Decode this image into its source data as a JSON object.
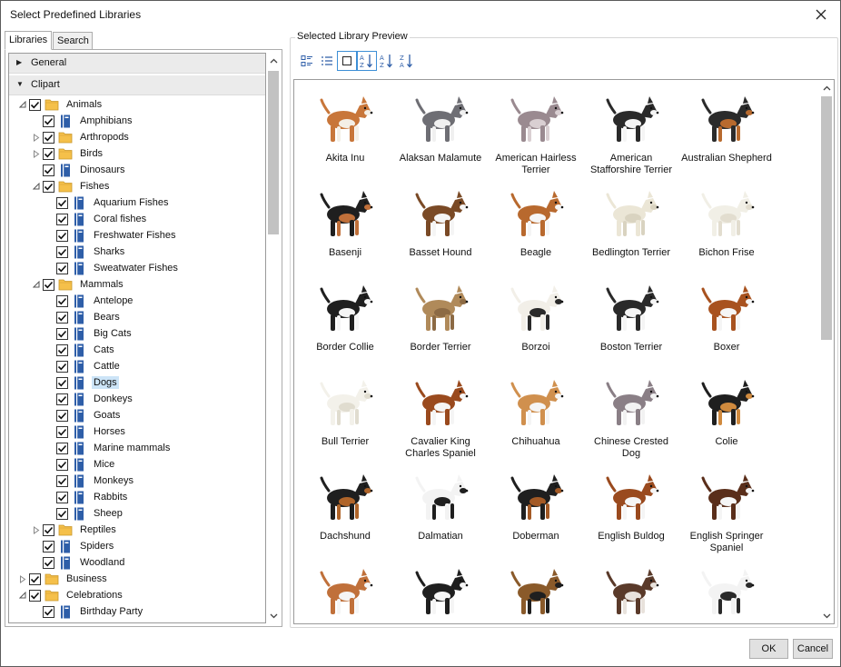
{
  "window": {
    "title": "Select Predefined Libraries"
  },
  "tabs": [
    {
      "label": "Libraries",
      "active": true
    },
    {
      "label": "Search",
      "active": false
    }
  ],
  "groups": [
    {
      "label": "General",
      "expanded": false
    },
    {
      "label": "Clipart",
      "expanded": true
    }
  ],
  "tree": [
    {
      "label": "Animals",
      "level": 0,
      "type": "folder",
      "expander": "open",
      "checked": true
    },
    {
      "label": "Amphibians",
      "level": 1,
      "type": "book",
      "expander": "none",
      "checked": true
    },
    {
      "label": "Arthropods",
      "level": 1,
      "type": "folder",
      "expander": "closed",
      "checked": true
    },
    {
      "label": "Birds",
      "level": 1,
      "type": "folder",
      "expander": "closed",
      "checked": true
    },
    {
      "label": "Dinosaurs",
      "level": 1,
      "type": "book",
      "expander": "none",
      "checked": true
    },
    {
      "label": "Fishes",
      "level": 1,
      "type": "folder",
      "expander": "open",
      "checked": true
    },
    {
      "label": "Aquarium Fishes",
      "level": 2,
      "type": "book",
      "expander": "none",
      "checked": true
    },
    {
      "label": "Coral fishes",
      "level": 2,
      "type": "book",
      "expander": "none",
      "checked": true
    },
    {
      "label": "Freshwater Fishes",
      "level": 2,
      "type": "book",
      "expander": "none",
      "checked": true
    },
    {
      "label": "Sharks",
      "level": 2,
      "type": "book",
      "expander": "none",
      "checked": true
    },
    {
      "label": "Sweatwater Fishes",
      "level": 2,
      "type": "book",
      "expander": "none",
      "checked": true
    },
    {
      "label": "Mammals",
      "level": 1,
      "type": "folder",
      "expander": "open",
      "checked": true
    },
    {
      "label": "Antelope",
      "level": 2,
      "type": "book",
      "expander": "none",
      "checked": true
    },
    {
      "label": "Bears",
      "level": 2,
      "type": "book",
      "expander": "none",
      "checked": true
    },
    {
      "label": "Big Cats",
      "level": 2,
      "type": "book",
      "expander": "none",
      "checked": true
    },
    {
      "label": "Cats",
      "level": 2,
      "type": "book",
      "expander": "none",
      "checked": true
    },
    {
      "label": "Cattle",
      "level": 2,
      "type": "book",
      "expander": "none",
      "checked": true
    },
    {
      "label": "Dogs",
      "level": 2,
      "type": "book",
      "expander": "none",
      "checked": true,
      "selected": true
    },
    {
      "label": "Donkeys",
      "level": 2,
      "type": "book",
      "expander": "none",
      "checked": true
    },
    {
      "label": "Goats",
      "level": 2,
      "type": "book",
      "expander": "none",
      "checked": true
    },
    {
      "label": "Horses",
      "level": 2,
      "type": "book",
      "expander": "none",
      "checked": true
    },
    {
      "label": "Marine mammals",
      "level": 2,
      "type": "book",
      "expander": "none",
      "checked": true
    },
    {
      "label": "Mice",
      "level": 2,
      "type": "book",
      "expander": "none",
      "checked": true
    },
    {
      "label": "Monkeys",
      "level": 2,
      "type": "book",
      "expander": "none",
      "checked": true
    },
    {
      "label": "Rabbits",
      "level": 2,
      "type": "book",
      "expander": "none",
      "checked": true
    },
    {
      "label": "Sheep",
      "level": 2,
      "type": "book",
      "expander": "none",
      "checked": true
    },
    {
      "label": "Reptiles",
      "level": 1,
      "type": "folder",
      "expander": "closed",
      "checked": true
    },
    {
      "label": "Spiders",
      "level": 1,
      "type": "book",
      "expander": "none",
      "checked": true
    },
    {
      "label": "Woodland",
      "level": 1,
      "type": "book",
      "expander": "none",
      "checked": true
    },
    {
      "label": "Business",
      "level": 0,
      "type": "folder",
      "expander": "closed",
      "checked": true
    },
    {
      "label": "Celebrations",
      "level": 0,
      "type": "folder",
      "expander": "open",
      "checked": true
    },
    {
      "label": "Birthday Party",
      "level": 1,
      "type": "book",
      "expander": "none",
      "checked": true
    }
  ],
  "preview": {
    "legend": "Selected Library Preview",
    "view_modes": [
      "details-icon",
      "list-icon",
      "thumbnail-icon",
      "sort-az-icon",
      "sort-ascending-icon",
      "sort-descending-icon"
    ],
    "active_view": "thumbnail-icon",
    "items": [
      {
        "name": "Akita Inu",
        "coat": "#c8763a",
        "accent": "#f4efe6"
      },
      {
        "name": "Alaksan Malamute",
        "coat": "#6e6e74",
        "accent": "#f0f0f0"
      },
      {
        "name": "American Hairless Terrier",
        "coat": "#9a8a90",
        "accent": "#d9cfd2"
      },
      {
        "name": "American Stafforshire Terrier",
        "coat": "#2a2a2a",
        "accent": "#f5f5f5"
      },
      {
        "name": "Australian Shepherd",
        "coat": "#2b2b2b",
        "accent": "#b86a2e"
      },
      {
        "name": "Basenji",
        "coat": "#1f1f1f",
        "accent": "#c0703a"
      },
      {
        "name": "Basset Hound",
        "coat": "#7a4a26",
        "accent": "#f5f5f5"
      },
      {
        "name": "Beagle",
        "coat": "#b8692e",
        "accent": "#f5f5f5"
      },
      {
        "name": "Bedlington Terrier",
        "coat": "#ebe6d6",
        "accent": "#d9d3c0"
      },
      {
        "name": "Bichon Frise",
        "coat": "#f1efe6",
        "accent": "#e2ddcf"
      },
      {
        "name": "Border Collie",
        "coat": "#1f1f1f",
        "accent": "#f5f5f5"
      },
      {
        "name": "Border Terrier",
        "coat": "#b08a5a",
        "accent": "#8c6a44"
      },
      {
        "name": "Borzoi",
        "coat": "#f2efe8",
        "accent": "#2a2a2a"
      },
      {
        "name": "Boston Terrier",
        "coat": "#2a2a2a",
        "accent": "#f5f5f5"
      },
      {
        "name": "Boxer",
        "coat": "#a8521f",
        "accent": "#f5f5f5"
      },
      {
        "name": "Bull Terrier",
        "coat": "#f3f1ea",
        "accent": "#e0dccf"
      },
      {
        "name": "Cavalier King Charles Spaniel",
        "coat": "#9a4a1e",
        "accent": "#f5f5f5"
      },
      {
        "name": "Chihuahua",
        "coat": "#d0904e",
        "accent": "#f5f5f5"
      },
      {
        "name": "Chinese Crested Dog",
        "coat": "#8a7f86",
        "accent": "#f2f2f2"
      },
      {
        "name": "Colie",
        "coat": "#1f1f1f",
        "accent": "#d08a3e"
      },
      {
        "name": "Dachshund",
        "coat": "#1f1f1f",
        "accent": "#b0652a"
      },
      {
        "name": "Dalmatian",
        "coat": "#f3f3f3",
        "accent": "#1f1f1f"
      },
      {
        "name": "Doberman",
        "coat": "#1f1f1f",
        "accent": "#a45a26"
      },
      {
        "name": "English Buldog",
        "coat": "#9a4a1e",
        "accent": "#f5f5f5"
      },
      {
        "name": "English Springer Spaniel",
        "coat": "#5a2e1a",
        "accent": "#f5f5f5"
      },
      {
        "name": "",
        "coat": "#c0703a",
        "accent": "#f5f5f5"
      },
      {
        "name": "",
        "coat": "#1f1f1f",
        "accent": "#f5f5f5"
      },
      {
        "name": "",
        "coat": "#8a5a2a",
        "accent": "#1f1f1f"
      },
      {
        "name": "",
        "coat": "#5a3a2a",
        "accent": "#e8e2dc"
      },
      {
        "name": "",
        "coat": "#f3f3f3",
        "accent": "#2a2a2a"
      }
    ]
  },
  "buttons": {
    "ok": "OK",
    "cancel": "Cancel"
  },
  "colors": {
    "selection": "#cce4f7",
    "folder": "#f5c04a",
    "book": "#2e5ea8",
    "accent": "#3d8fd6"
  }
}
